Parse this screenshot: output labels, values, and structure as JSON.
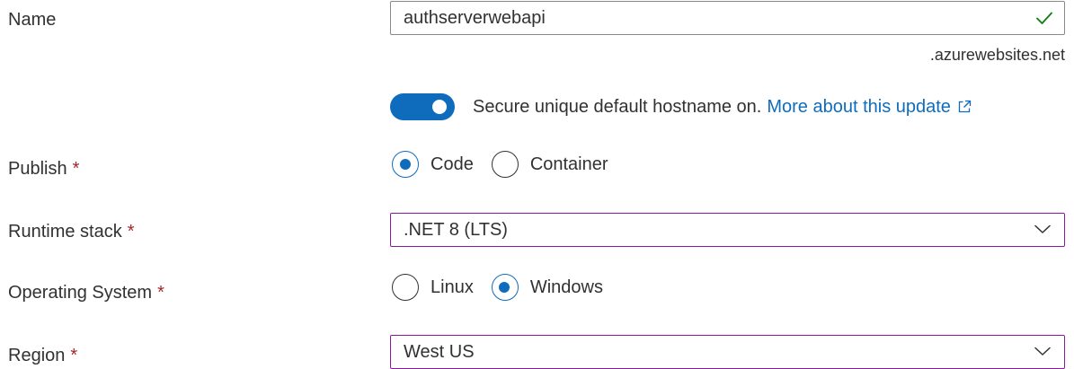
{
  "name": {
    "label": "Name",
    "value": "authserverwebapi",
    "suffix": ".azurewebsites.net",
    "valid": true
  },
  "hostname": {
    "toggle_on": true,
    "text": "Secure unique default hostname on.",
    "link": "More about this update"
  },
  "publish": {
    "label": "Publish",
    "required_mark": "*",
    "options": [
      "Code",
      "Container"
    ],
    "selected": "Code"
  },
  "runtime": {
    "label": "Runtime stack",
    "required_mark": "*",
    "value": ".NET 8 (LTS)"
  },
  "os": {
    "label": "Operating System",
    "required_mark": "*",
    "options": [
      "Linux",
      "Windows"
    ],
    "selected": "Windows"
  },
  "region": {
    "label": "Region",
    "required_mark": "*",
    "value": "West US"
  },
  "colors": {
    "accent": "#0f6cbd",
    "required": "#a4262c",
    "valid_check": "#107c10",
    "focus_border": "#8a1a9c"
  },
  "icons": {
    "valid": "checkmark-icon",
    "external": "external-link-icon",
    "dropdown": "chevron-down-icon"
  }
}
